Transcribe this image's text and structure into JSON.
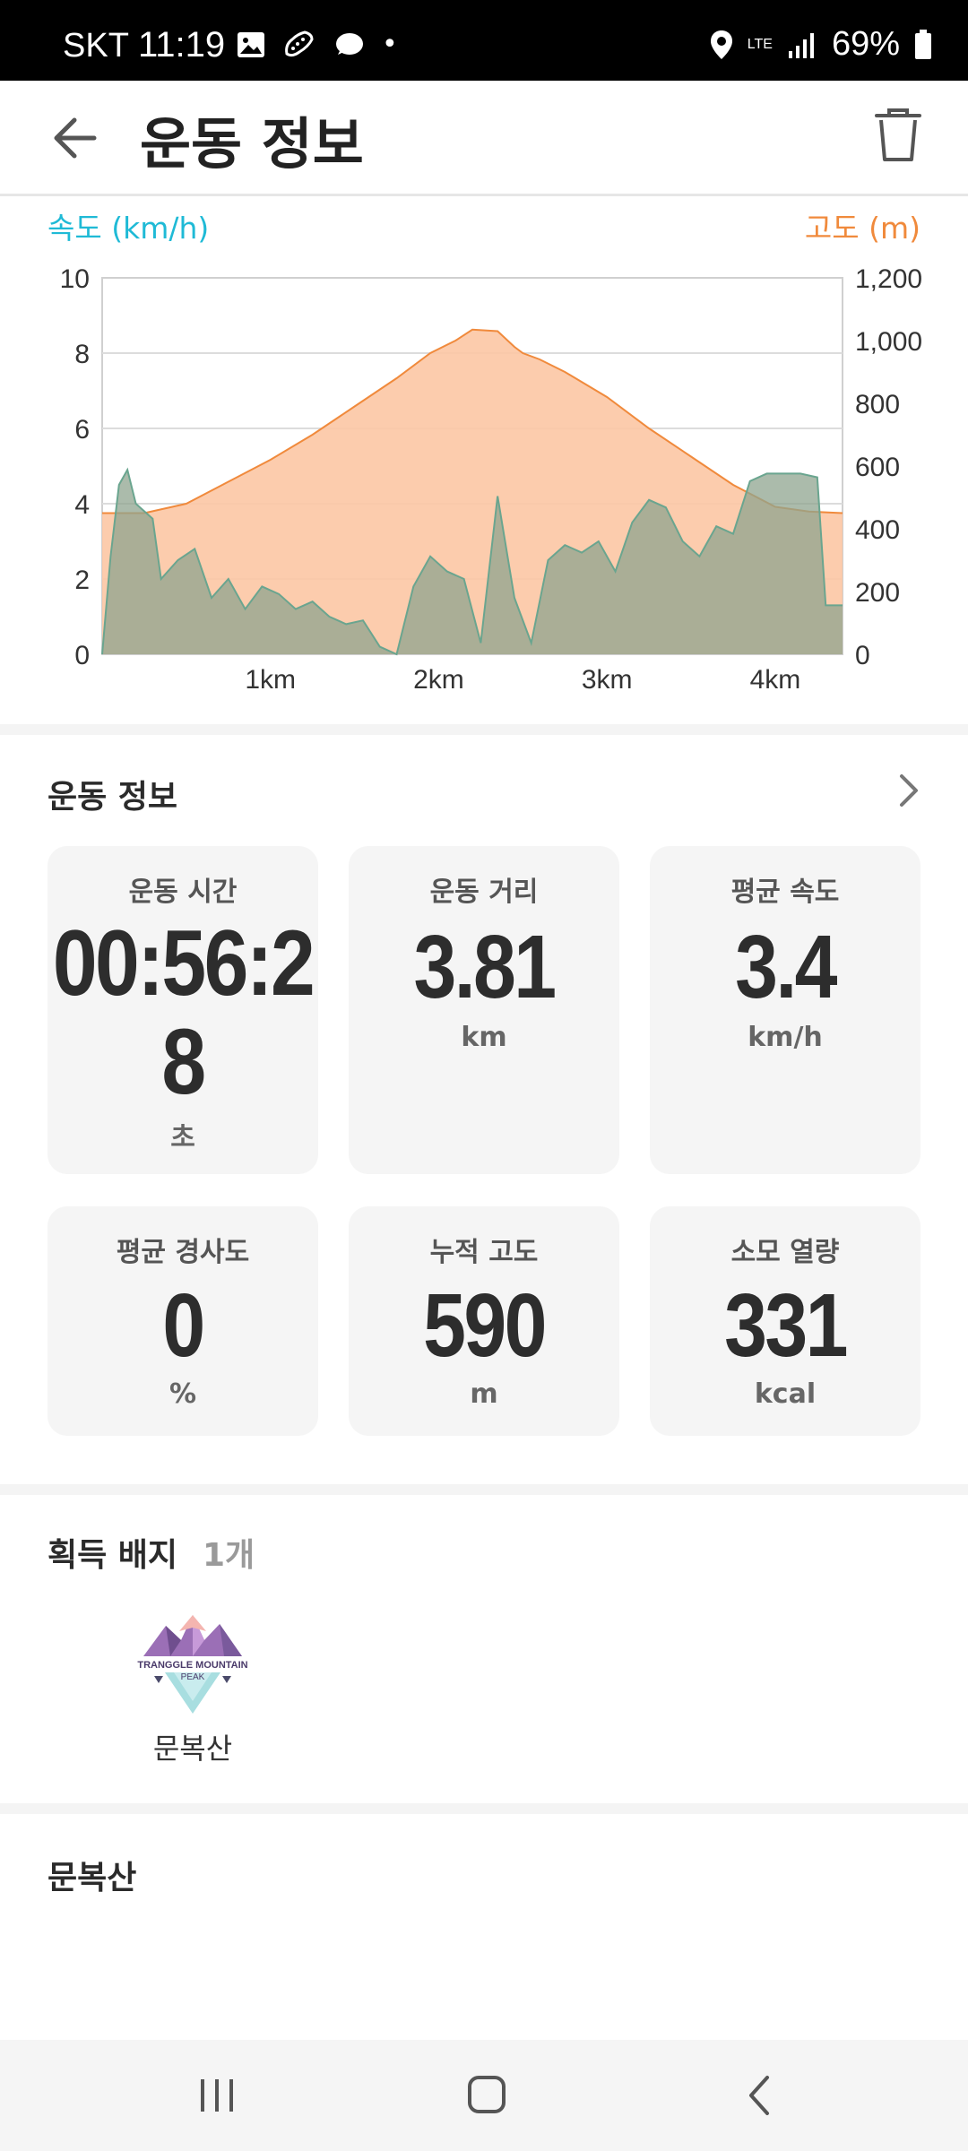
{
  "status_bar": {
    "carrier": "SKT",
    "time": "11:19",
    "dot": "•",
    "network": "LTE",
    "battery": "69%"
  },
  "header": {
    "title": "운동 정보",
    "back_icon": "arrow-left-icon",
    "delete_icon": "trash-icon"
  },
  "chart_data": {
    "type": "area",
    "left_axis_title": "속도 (km/h)",
    "right_axis_title": "고도 (m)",
    "y_left_ticks": [
      "10",
      "8",
      "6",
      "4",
      "2",
      "0"
    ],
    "y_right_ticks": [
      "1,200",
      "1,000",
      "800",
      "600",
      "400",
      "200",
      "0"
    ],
    "x_ticks": [
      "1km",
      "2km",
      "3km",
      "4km"
    ],
    "ylim_left": [
      0,
      10
    ],
    "ylim_right": [
      0,
      1200
    ],
    "xlim_km": [
      0,
      4.4
    ],
    "grid": true,
    "colors": {
      "speed": "#1fbad6",
      "altitude": "#f08a3c",
      "altitude_fill": "#fcc6a4",
      "speed_fill": "#9ad8e6",
      "steps": "#8fa68f"
    },
    "series": [
      {
        "x": [
          0,
          0.25,
          0.5,
          0.75,
          1.0,
          1.25,
          1.5,
          1.75,
          1.95,
          2.1,
          2.2,
          2.35,
          2.45,
          2.5,
          2.6,
          2.75,
          3.0,
          3.25,
          3.5,
          3.75,
          4.0,
          4.2,
          4.4
        ],
        "y": [
          450,
          450,
          480,
          550,
          620,
          700,
          790,
          880,
          960,
          1000,
          1035,
          1030,
          980,
          960,
          940,
          900,
          820,
          720,
          630,
          540,
          470,
          455,
          450
        ]
      },
      {
        "x": [
          0,
          0.05,
          0.1,
          0.15,
          0.2,
          0.25,
          0.3,
          0.35,
          0.45,
          0.55,
          0.65,
          0.75,
          0.85,
          0.95,
          1.05,
          1.15,
          1.25,
          1.35,
          1.45,
          1.55,
          1.65,
          1.75,
          1.85,
          1.95,
          2.05,
          2.15,
          2.25,
          2.35,
          2.45,
          2.55,
          2.65,
          2.75,
          2.85,
          2.95,
          3.05,
          3.15,
          3.25,
          3.35,
          3.45,
          3.55,
          3.65,
          3.75,
          3.85,
          3.95,
          4.05,
          4.15,
          4.25,
          4.3,
          4.4
        ],
        "y": [
          0,
          2.6,
          4.5,
          4.9,
          4.0,
          3.8,
          3.6,
          2.0,
          2.5,
          2.8,
          1.5,
          2.0,
          1.2,
          1.8,
          1.6,
          1.2,
          1.4,
          1.0,
          0.8,
          0.9,
          0.2,
          0.0,
          1.8,
          2.6,
          2.2,
          2.0,
          0.3,
          4.2,
          1.5,
          0.3,
          2.5,
          2.9,
          2.7,
          3.0,
          2.2,
          3.5,
          4.1,
          3.9,
          3.0,
          2.6,
          3.4,
          3.2,
          4.6,
          4.8,
          4.8,
          4.8,
          4.7,
          1.3,
          1.3
        ]
      }
    ]
  },
  "exercise_info": {
    "title": "운동 정보",
    "cards": [
      {
        "label": "운동 시간",
        "value_line1": "00:56:2",
        "value_line2": "8",
        "unit": "초"
      },
      {
        "label": "운동 거리",
        "value": "3.81",
        "unit": "km"
      },
      {
        "label": "평균 속도",
        "value": "3.4",
        "unit": "km/h"
      },
      {
        "label": "평균 경사도",
        "value": "0",
        "unit": "%"
      },
      {
        "label": "누적 고도",
        "value": "590",
        "unit": "m"
      },
      {
        "label": "소모 열량",
        "value": "331",
        "unit": "kcal"
      }
    ]
  },
  "badges": {
    "title": "획득 배지",
    "count": "1개",
    "items": [
      {
        "name": "문복산",
        "logo_text_line1": "TRANGGLE MOUNTAIN",
        "logo_text_line2": "PEAK"
      }
    ]
  },
  "mountain": {
    "title": "문복산"
  },
  "navbar": {
    "recent_icon": "recent-apps-icon",
    "home_icon": "home-icon",
    "back_icon": "back-chevron-icon"
  }
}
